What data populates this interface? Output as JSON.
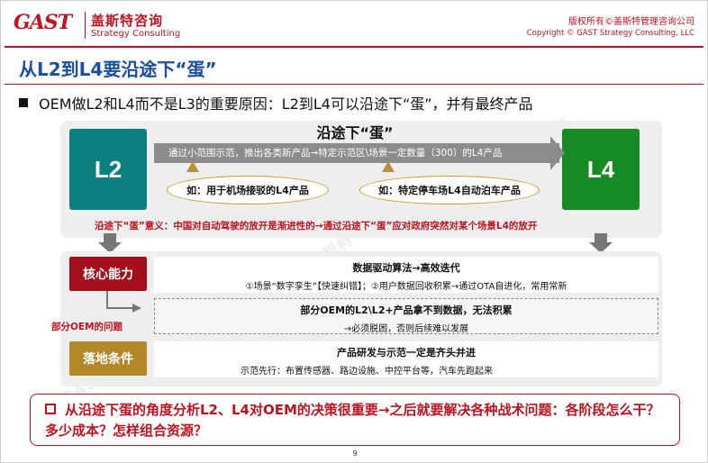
{
  "header": {
    "logo_text": "GAST",
    "company_cn": "盖斯特咨询",
    "company_en": "Strategy Consulting",
    "copyright_cn": "版权所有©盖斯特管理咨询公司",
    "copyright_en": "Copyright © GAST Strategy Consulting, LLC"
  },
  "title": "从L2到L4要沿途下“蛋”",
  "bullet": "OEM做L2和L4而不是L3的重要原因：L2到L4可以沿途下“蛋”，并有最终产品",
  "top_panel": {
    "title": "沿途下“蛋”",
    "l2": "L2",
    "l4": "L4",
    "arrow_text": "通过小范围示范，推出各类新产品→特定示范区\\场景一定数量（300）的L4产品",
    "example_1": "如：用于机场接驳的L4产品",
    "example_2": "如：特定停车场L4自动泊车产品",
    "meaning_label": "沿途下“蛋”意义：",
    "meaning_text": "中国对自动驾驶的放开是渐进性的→通过沿途下“蛋”应对政府突然对某个场景L4的放开"
  },
  "bottom_panel": {
    "core": {
      "tag": "核心能力",
      "line1": "数据驱动算法→高效迭代",
      "line2": "①场景“数字孪生”【快速纠错】；②用户数据回收积累→通过OTA自进化，常用常新"
    },
    "issue": {
      "label": "部分OEM的问题",
      "line1": "部分OEM的L2\\L2+产品拿不到数据，无法积累",
      "line2": "→必须脱困，否则后续难以发展"
    },
    "landing": {
      "tag": "落地条件",
      "line1": "产品研发与示范一定是齐头并进",
      "line2": "示范先行：布置传感器、路边设施、中控平台等，汽车先跑起来"
    }
  },
  "conclusion": "从沿途下蛋的角度分析L2、L4对OEM的决策很重要→之后就要解决各种战术问题：各阶段怎么干？多少成本？怎样组合资源？",
  "page_number": "9",
  "watermark": "GAST 盖斯特",
  "colors": {
    "brand_red": "#c0111f",
    "title_blue": "#1a4fa0",
    "l2_teal": "#0d7f80",
    "l4_green": "#168a23",
    "gold": "#b4872a"
  }
}
